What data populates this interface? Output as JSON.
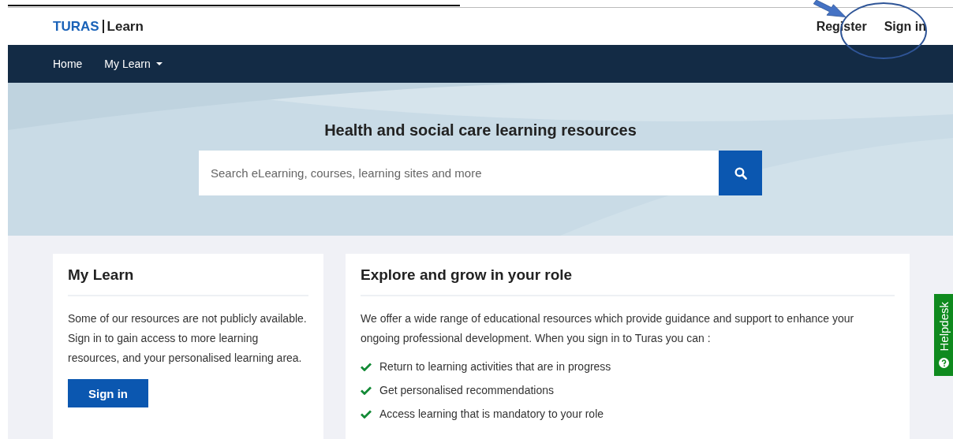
{
  "header": {
    "logo_brand": "TURAS",
    "logo_product": "Learn",
    "links": [
      "Register",
      "Sign in"
    ]
  },
  "nav": {
    "items": [
      {
        "label": "Home",
        "dropdown": false
      },
      {
        "label": "My Learn",
        "dropdown": true
      }
    ]
  },
  "hero": {
    "title": "Health and social care learning resources",
    "search": {
      "placeholder": "Search eLearning, courses, learning sites and more"
    }
  },
  "my_learn": {
    "title": "My Learn",
    "text": "Some of our resources are not publicly available. Sign in to gain access to more learning resources, and your personalised learning area.",
    "button": "Sign in"
  },
  "explore": {
    "title": "Explore and grow in your role",
    "text": "We offer a wide range of educational resources which provide guidance and support to enhance your ongoing professional development. When you sign in to Turas you can :",
    "benefits": [
      "Return to learning activities that are in progress",
      "Get personalised recommendations",
      "Access learning that is mandatory to your role"
    ]
  },
  "helpdesk": {
    "label": "Helpdesk"
  }
}
